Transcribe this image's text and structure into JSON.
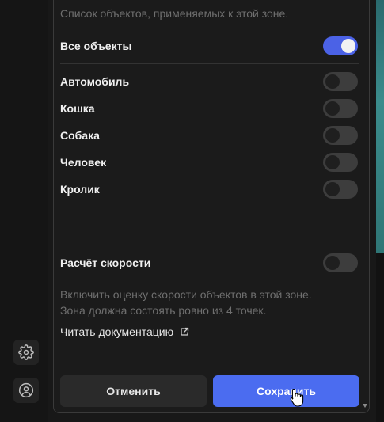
{
  "sidebar": {
    "icons": [
      "gear-icon",
      "user-circle-icon"
    ]
  },
  "dialog": {
    "objects_description": "Список объектов, применяемых к этой зоне.",
    "all_objects": {
      "label": "Все объекты",
      "enabled": true
    },
    "objects": [
      {
        "label": "Автомобиль",
        "enabled": false
      },
      {
        "label": "Кошка",
        "enabled": false
      },
      {
        "label": "Собака",
        "enabled": false
      },
      {
        "label": "Человек",
        "enabled": false
      },
      {
        "label": "Кролик",
        "enabled": false
      }
    ],
    "speed": {
      "label": "Расчёт скорости",
      "enabled": false,
      "description_line1": "Включить оценку скорости объектов в этой зоне.",
      "description_line2": "Зона должна состоять ровно из 4 точек."
    },
    "doc_link": "Читать документацию",
    "cancel_label": "Отменить",
    "save_label": "Сохранить"
  },
  "colors": {
    "accent": "#4b6cf0",
    "toggle_on": "#4b62e6",
    "toggle_off": "#3d3d3d"
  }
}
